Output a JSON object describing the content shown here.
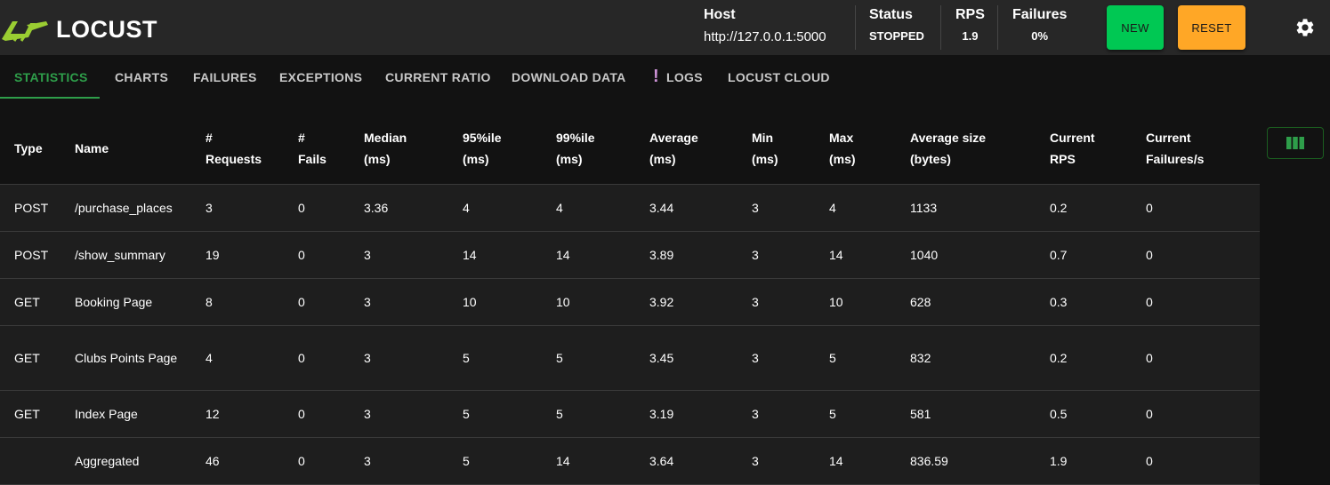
{
  "app": {
    "name": "LOCUST",
    "brand_color": "#9acd32",
    "accent_color": "#2e9e4a"
  },
  "header": {
    "host_label": "Host",
    "host_value": "http://127.0.0.1:5000",
    "status_label": "Status",
    "status_value": "STOPPED",
    "rps_label": "RPS",
    "rps_value": "1.9",
    "failures_label": "Failures",
    "failures_value": "0%",
    "new_button": "NEW",
    "reset_button": "RESET",
    "settings_icon": "gear-icon"
  },
  "tabs": [
    {
      "label": "STATISTICS",
      "active": true
    },
    {
      "label": "CHARTS"
    },
    {
      "label": "FAILURES"
    },
    {
      "label": "EXCEPTIONS"
    },
    {
      "label": "CURRENT RATIO"
    },
    {
      "label": "DOWNLOAD DATA"
    },
    {
      "label": "LOGS",
      "icon": "exclamation-icon"
    },
    {
      "label": "LOCUST CLOUD"
    }
  ],
  "table": {
    "columns": [
      "Type",
      "Name",
      "# Requests",
      "# Fails",
      "Median (ms)",
      "95%ile (ms)",
      "99%ile (ms)",
      "Average (ms)",
      "Min (ms)",
      "Max (ms)",
      "Average size (bytes)",
      "Current RPS",
      "Current Failures/s"
    ],
    "header_lines": [
      [
        "Type"
      ],
      [
        "Name"
      ],
      [
        "#",
        "Requests"
      ],
      [
        "#",
        "Fails"
      ],
      [
        "Median",
        "(ms)"
      ],
      [
        "95%ile",
        "(ms)"
      ],
      [
        "99%ile",
        "(ms)"
      ],
      [
        "Average",
        "(ms)"
      ],
      [
        "Min",
        "(ms)"
      ],
      [
        "Max",
        "(ms)"
      ],
      [
        "Average size",
        "(bytes)"
      ],
      [
        "Current",
        "RPS"
      ],
      [
        "Current",
        "Failures/s"
      ]
    ],
    "rows": [
      [
        "POST",
        "/purchase_places",
        "3",
        "0",
        "3.36",
        "4",
        "4",
        "3.44",
        "3",
        "4",
        "1133",
        "0.2",
        "0"
      ],
      [
        "POST",
        "/show_summary",
        "19",
        "0",
        "3",
        "14",
        "14",
        "3.89",
        "3",
        "14",
        "1040",
        "0.7",
        "0"
      ],
      [
        "GET",
        "Booking Page",
        "8",
        "0",
        "3",
        "10",
        "10",
        "3.92",
        "3",
        "10",
        "628",
        "0.3",
        "0"
      ],
      [
        "GET",
        "Clubs Points Page",
        "4",
        "0",
        "3",
        "5",
        "5",
        "3.45",
        "3",
        "5",
        "832",
        "0.2",
        "0"
      ],
      [
        "GET",
        "Index Page",
        "12",
        "0",
        "3",
        "5",
        "5",
        "3.19",
        "3",
        "5",
        "581",
        "0.5",
        "0"
      ],
      [
        "",
        "Aggregated",
        "46",
        "0",
        "3",
        "5",
        "14",
        "3.64",
        "3",
        "14",
        "836.59",
        "1.9",
        "0"
      ]
    ],
    "column_selector_icon": "columns-icon"
  }
}
